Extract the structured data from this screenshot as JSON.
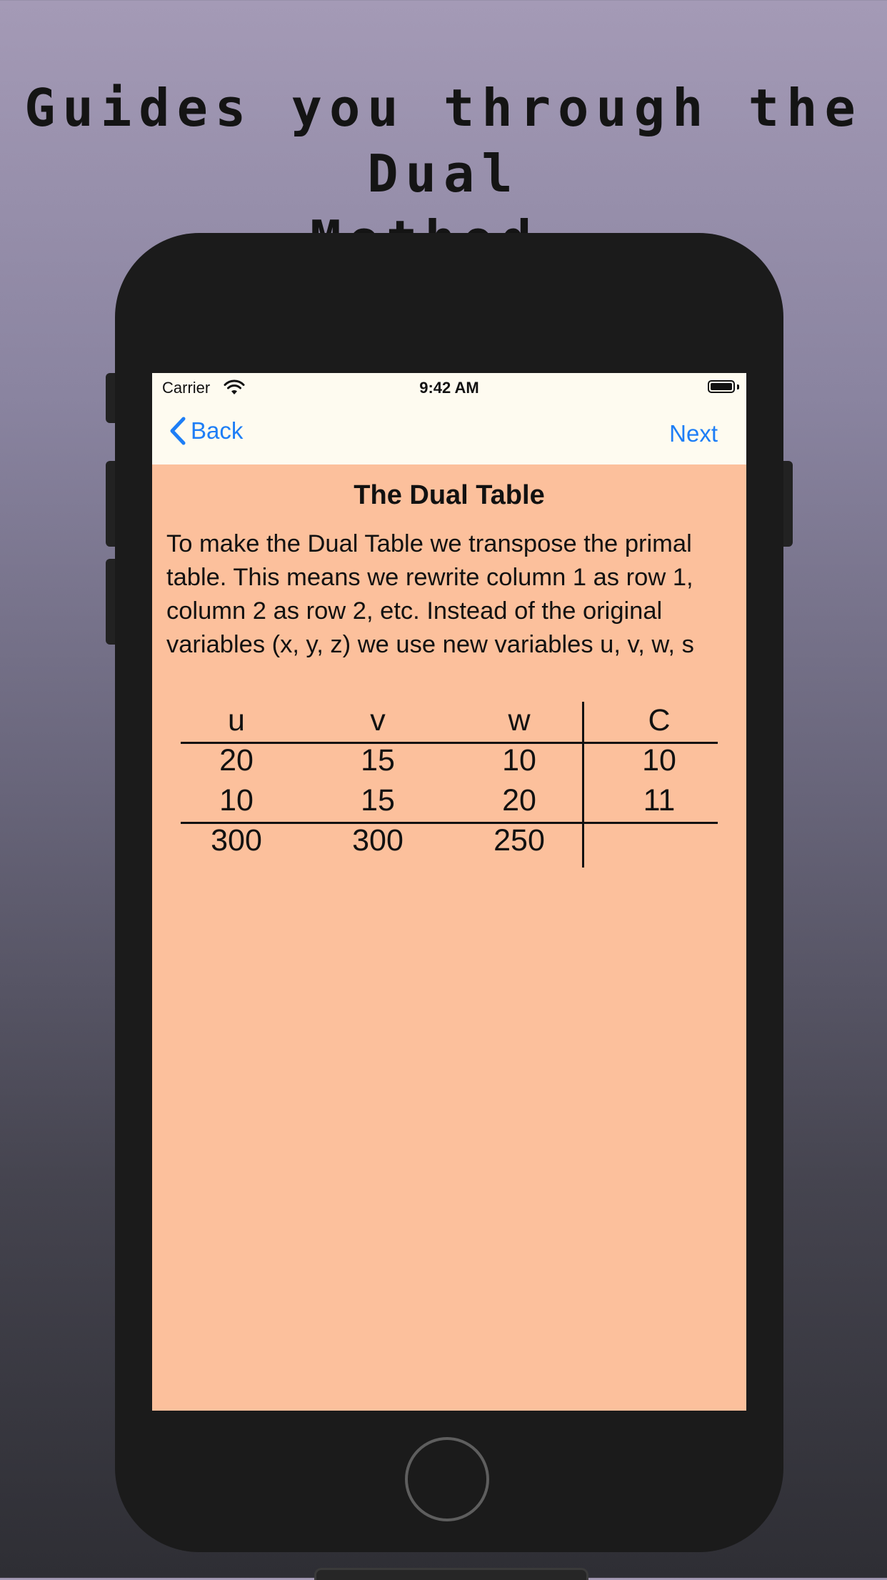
{
  "headline": [
    "Guides you through the Dual",
    "Method."
  ],
  "status_bar": {
    "carrier": "Carrier",
    "time": "9:42 AM"
  },
  "nav": {
    "back_label": "Back",
    "next_label": "Next"
  },
  "page": {
    "title": "The Dual Table",
    "body": "To make the Dual Table we transpose the primal table.  This means we rewrite column 1 as row 1, column 2 as row 2, etc.  Instead of the original variables (x, y, z) we use new variables u, v, w, s"
  },
  "table": {
    "headers": [
      "u",
      "v",
      "w",
      "C"
    ],
    "rows": [
      [
        "20",
        "15",
        "10",
        "10"
      ],
      [
        "10",
        "15",
        "20",
        "11"
      ]
    ],
    "bottom_row": [
      "300",
      "300",
      "250",
      ""
    ]
  },
  "colors": {
    "screen_bg": "#fcc09c",
    "bar_bg": "#fefbf0",
    "accent": "#1e7ef6"
  },
  "icons": [
    "wifi-icon",
    "battery-icon",
    "chevron-left-icon",
    "home-button"
  ]
}
